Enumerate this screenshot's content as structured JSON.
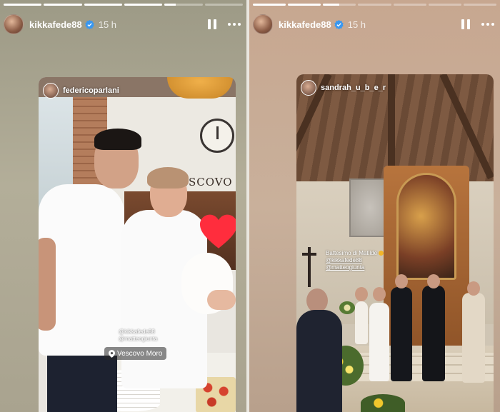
{
  "stories": [
    {
      "progress": [
        1,
        1,
        1,
        1,
        0.3,
        0
      ],
      "header": {
        "username": "kikkafede88",
        "time": "15 h"
      },
      "tag": {
        "username": "federicoparlani"
      },
      "sign_text": "ESCOVO M",
      "mentions": [
        "@kikkafede88",
        "@matteogiunta"
      ],
      "location": "Vescovo Moro"
    },
    {
      "progress": [
        1,
        1,
        0.5,
        0,
        0,
        0,
        0
      ],
      "header": {
        "username": "kikkafede88",
        "time": "15 h"
      },
      "tag": {
        "username": "sandrah_u_b_e_r"
      },
      "caption": {
        "title": "Battesimo di Matilde",
        "mention1": "@kikkafede88",
        "mention2": "@matteogiunta"
      }
    }
  ],
  "colors": {
    "verified": "#3897f0",
    "heart": "#ff2d3d"
  },
  "icons": [
    "avatar-icon",
    "verified-icon",
    "pause-icon",
    "more-icon",
    "heart-sticker-icon",
    "location-pin-icon"
  ]
}
